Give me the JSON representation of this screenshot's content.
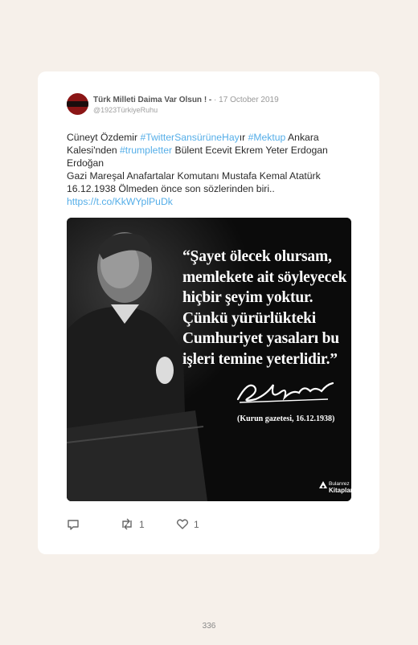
{
  "tweet": {
    "display_name": "Türk Milleti Daima Var Olsun ! -",
    "separator": "·",
    "date": "17 October 2019",
    "handle": "@1923TürkiyeRuhu",
    "text": {
      "p1": "Cüneyt Özdemir ",
      "tag1": "#TwitterSansürüneHay",
      "p2": "ır ",
      "tag2": "#Mektup",
      "p3": " Ankara Kalesi'nden ",
      "tag3": "#trumpletter",
      "p4": " Bülent Ecevit Ekrem Yeter Erdogan Erdoğan",
      "line2": "Gazi Mareşal Anafartalar Komutanı Mustafa Kemal Atatürk 16.12.1938 Ölmeden önce son sözlerinden biri..",
      "link": "https://t.co/KkWYplPuDk"
    },
    "image": {
      "quote": "“Şayet ölecek olursam, memlekete ait söyleyecek hiçbir şeyim yoktur. Çünkü yürürlükteki Cumhuriyet yasaları bu işleri temine yeterlidir.”",
      "source": "(Kurun gazetesi, 16.12.1938)",
      "logo_line1": "Bulanrez",
      "logo_line2": "Kitaplar"
    },
    "actions": {
      "reply_icon": "reply-icon",
      "retweet_icon": "retweet-icon",
      "retweet_count": "1",
      "like_icon": "heart-icon",
      "like_count": "1"
    }
  },
  "page_number": "336",
  "colors": {
    "background": "#f6f0ea",
    "card": "#ffffff",
    "hashtag": "#55aee8",
    "image_bg": "#0b0b0b"
  }
}
